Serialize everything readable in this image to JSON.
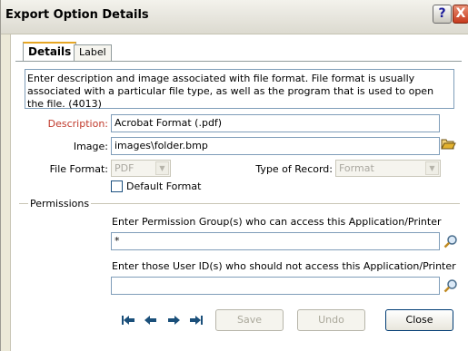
{
  "window": {
    "title": "Export Option Details",
    "help_label": "?",
    "close_label": "X"
  },
  "tabs": [
    {
      "label": "Details",
      "active": true
    },
    {
      "label": "Label",
      "active": false
    }
  ],
  "details": {
    "help_text": "Enter description and image associated with file format. File format is usually associated with a particular file type, as well as the program that is used to open the file. (4013)",
    "description_label": "Description:",
    "description_value": "Acrobat Format (.pdf)",
    "image_label": "Image:",
    "image_value": "images\\folder.bmp",
    "file_format_label": "File Format:",
    "file_format_value": "PDF",
    "record_type_label": "Type of Record:",
    "record_type_value": "Format",
    "default_format_label": "Default Format",
    "default_format_checked": false
  },
  "permissions": {
    "legend": "Permissions",
    "groups_prompt": "Enter Permission Group(s) who can access this Application/Printer",
    "groups_value": "*",
    "users_prompt": "Enter those User ID(s) who should not access this Application/Printer",
    "users_value": ""
  },
  "buttons": {
    "save": "Save",
    "undo": "Undo",
    "close": "Close"
  },
  "colors": {
    "required_label": "#c0392b",
    "nav_arrow": "#1a4f7a"
  }
}
